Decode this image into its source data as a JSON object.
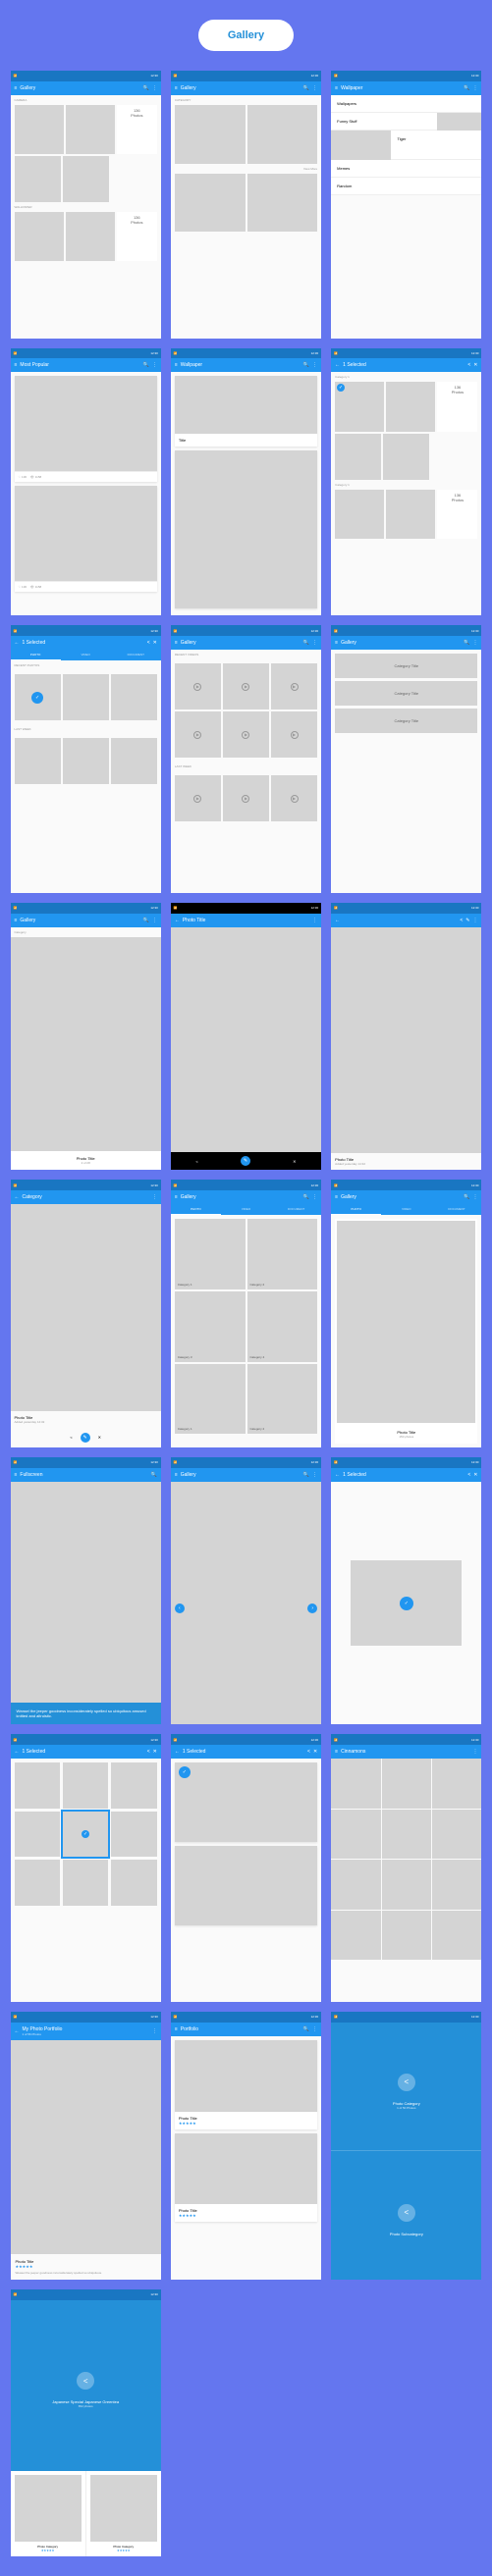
{
  "page_title": "Gallery",
  "status": {
    "net": "📶",
    "time": "12:30"
  },
  "icons": {
    "menu": "≡",
    "back": "←",
    "search": "🔍",
    "more": "⋮",
    "share": "<",
    "close": "✕",
    "edit": "✎",
    "check": "✓",
    "play": "▶",
    "left": "‹",
    "right": "›"
  },
  "screens": {
    "s1": {
      "title": "Gallery",
      "sec1": "CAMERA",
      "count1": "136",
      "sub1": "Photos",
      "sec2": "WALLPAPER",
      "count2": "136"
    },
    "s2": {
      "title": "Gallery",
      "sec": "CATEGORY",
      "link": "View More"
    },
    "s3": {
      "title": "Wallpaper",
      "rows": [
        "Wallpapers",
        "Funny Stuff",
        "Memes",
        "Tiger",
        "Random"
      ]
    },
    "s4": {
      "title": "Most Popular",
      "like": "136",
      "view": "1158"
    },
    "s5": {
      "title": "Wallpaper",
      "card": "Title"
    },
    "s6": {
      "title": "1 Selected",
      "cat": "Category 1",
      "count": "136",
      "sub": "Photos"
    },
    "s7": {
      "title": "1 Selected",
      "tabs": [
        "PHOTO",
        "VIDEO",
        "DOCUMENT"
      ],
      "sec1": "RECENT PHOTOS",
      "sec2": "LAST WEEK"
    },
    "s8": {
      "title": "Gallery",
      "sec1": "RECENT VIDEOS",
      "sec2": "LAST WEEK"
    },
    "s9": {
      "title": "Gallery",
      "tiles": [
        "Category Title",
        "Category Title",
        "Category Title"
      ]
    },
    "s10": {
      "title": "Gallery",
      "label": "Category",
      "photo": "Photo Title",
      "sub": "2 of 28"
    },
    "s11": {
      "title": "Photo Title"
    },
    "s12": {
      "photo": "Photo Title",
      "sub": "Added yesterday 14:32"
    },
    "s13": {
      "title": "Category",
      "photo": "Photo Title",
      "sub": "Added yesterday 14:32"
    },
    "s14": {
      "title": "Gallery",
      "tabs": [
        "PHOTO",
        "VIDEO",
        "DOCUMENT"
      ],
      "tiles": [
        "Category 1",
        "Category 2",
        "Category 3",
        "Category 4"
      ]
    },
    "s15": {
      "title": "Gallery",
      "tabs": [
        "PHOTO",
        "VIDEO",
        "DOCUMENT"
      ],
      "photo": "Photo Title",
      "sub": "150 photos"
    },
    "s16": {
      "title": "Fullscreen",
      "text": "Weasel the jeeper goodness inconsiderately spelled so ubiquitous amused knitted and altruistic."
    },
    "s17": {
      "title": "Gallery"
    },
    "s18": {
      "title": "1 Selected"
    },
    "s19": {
      "title": "1 Selected"
    },
    "s20": {
      "title": "1 Selected"
    },
    "s21": {
      "title": "Cinnamons"
    },
    "s22": {
      "title": "My Photo Portfolio",
      "sub": "1 of 56 Photos",
      "photo": "Photo Title",
      "desc": "Weasel the jeeper goodness inconsiderately spelled so ubiquitous."
    },
    "s23": {
      "title": "Portfolio",
      "p1": "Photo Title",
      "p2": "Photo Title"
    },
    "s24": {
      "t1": "Photo Category",
      "s1": "1 of 50 Photos",
      "t2": "Photo Subcategory"
    },
    "s25": {
      "title": "Japanese Special Japanese Greentea",
      "sub": "652 photos",
      "c1": "Photo Category",
      "c2": "Photo Category"
    }
  }
}
